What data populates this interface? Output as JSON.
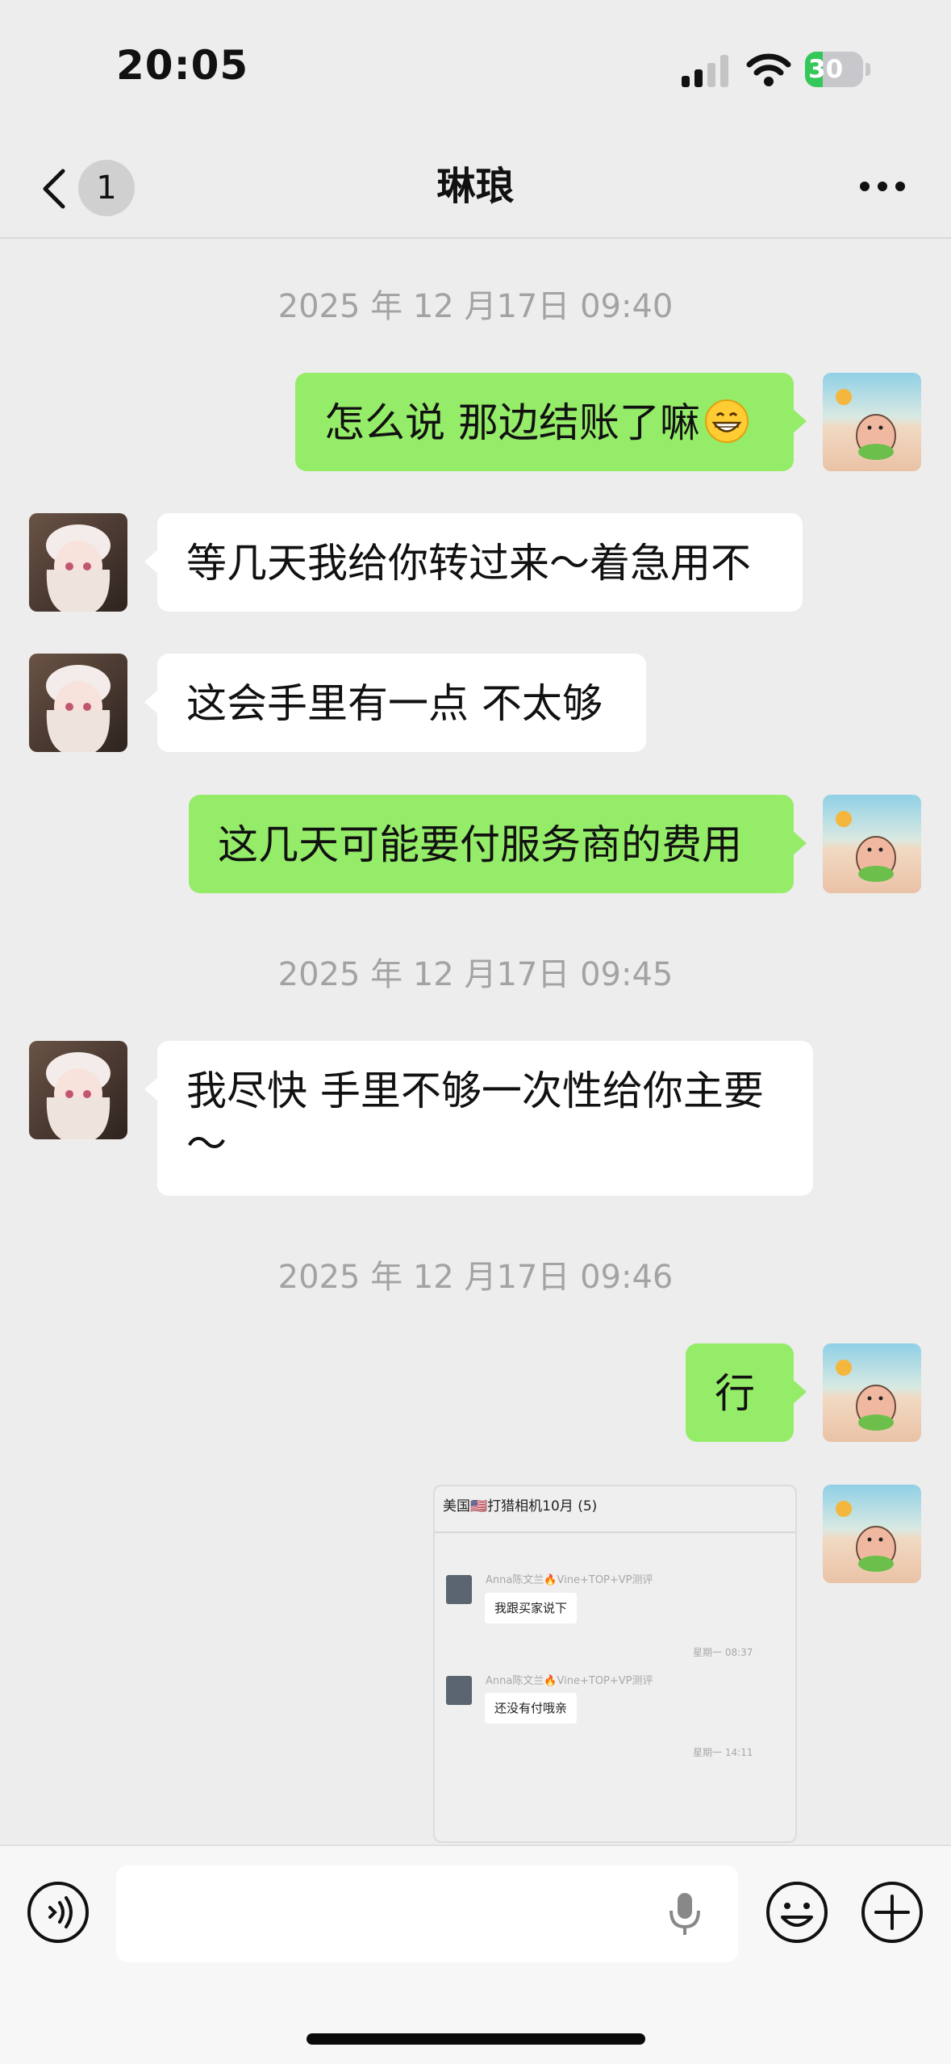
{
  "status_bar": {
    "time": "20:05",
    "battery_level": "30",
    "battery_percent": 30
  },
  "nav": {
    "back_count": "1",
    "title": "琳琅"
  },
  "messages": {
    "ts1": "2025 年 12 月17日 09:40",
    "m1": "怎么说 那边结账了嘛",
    "m1_emoji": "grinning-face-emoji",
    "m2": "等几天我给你转过来～着急用不",
    "m3": "这会手里有一点 不太够",
    "m4": "这几天可能要付服务商的费用",
    "ts2": "2025 年 12 月17日 09:45",
    "m5_line1": "我尽快 手里不够一次性给你主要",
    "m5_line2": "～",
    "ts3": "2025 年 12 月17日 09:46",
    "m6": "行"
  },
  "forwarded_card": {
    "title": "美国🇺🇸打猎相机10月 (5)",
    "items": [
      {
        "sender": "Anna陈文兰🔥Vine+TOP+VP测评",
        "text": "我跟买家说下",
        "time": "星期一 08:37"
      },
      {
        "sender": "Anna陈文兰🔥Vine+TOP+VP测评",
        "text": "还没有付哦亲",
        "time": "星期一 14:11"
      }
    ]
  },
  "input": {
    "placeholder": ""
  },
  "colors": {
    "bubble_out": "#95ec69",
    "bubble_in": "#ffffff",
    "background": "#ededed",
    "timestamp": "#a3a3a3"
  }
}
